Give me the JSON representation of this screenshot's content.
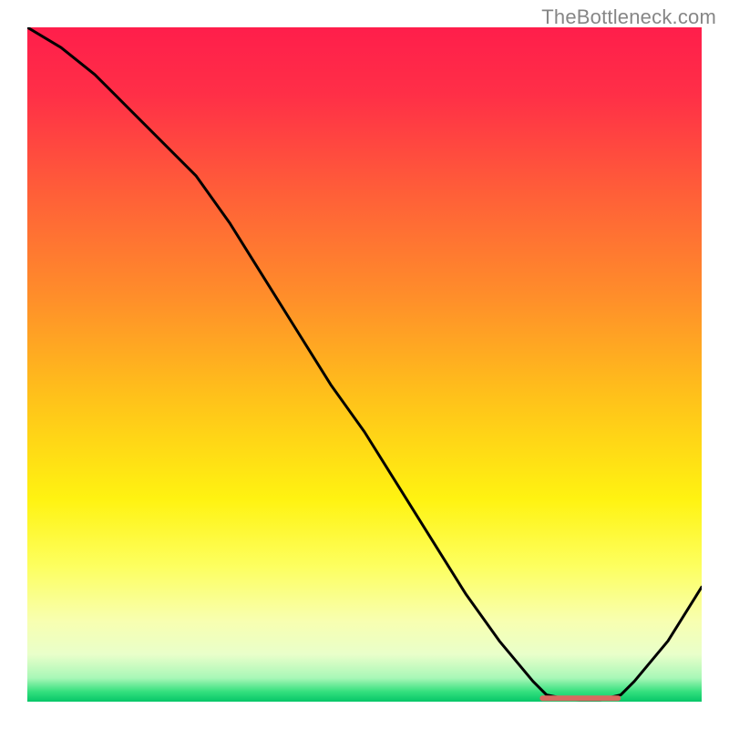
{
  "watermark": "TheBottleneck.com",
  "chart_data": {
    "type": "line",
    "title": "",
    "xlabel": "",
    "ylabel": "",
    "xlim": [
      0,
      100
    ],
    "ylim": [
      0,
      100
    ],
    "x": [
      0,
      5,
      10,
      15,
      20,
      25,
      30,
      35,
      40,
      45,
      50,
      55,
      60,
      65,
      70,
      75,
      77,
      80,
      82,
      85,
      88,
      90,
      95,
      100
    ],
    "y": [
      100,
      97,
      93,
      88,
      83,
      78,
      71,
      63,
      55,
      47,
      40,
      32,
      24,
      16,
      9,
      3,
      1,
      0.4,
      0.3,
      0.3,
      1,
      3,
      9,
      17
    ],
    "valley_marker": {
      "x_start": 76,
      "x_end": 88,
      "y": 0.5
    },
    "gradient_stops": [
      {
        "offset": 0.0,
        "color": "#ff1e4b"
      },
      {
        "offset": 0.1,
        "color": "#ff2f47"
      },
      {
        "offset": 0.25,
        "color": "#ff6038"
      },
      {
        "offset": 0.4,
        "color": "#ff8e2a"
      },
      {
        "offset": 0.55,
        "color": "#ffc21a"
      },
      {
        "offset": 0.7,
        "color": "#fff311"
      },
      {
        "offset": 0.8,
        "color": "#fdff60"
      },
      {
        "offset": 0.88,
        "color": "#f8ffb0"
      },
      {
        "offset": 0.93,
        "color": "#e9ffca"
      },
      {
        "offset": 0.965,
        "color": "#a8f7b7"
      },
      {
        "offset": 0.985,
        "color": "#35e07e"
      },
      {
        "offset": 1.0,
        "color": "#06c668"
      }
    ],
    "line_color": "#000000",
    "marker_color": "#d96a60"
  }
}
